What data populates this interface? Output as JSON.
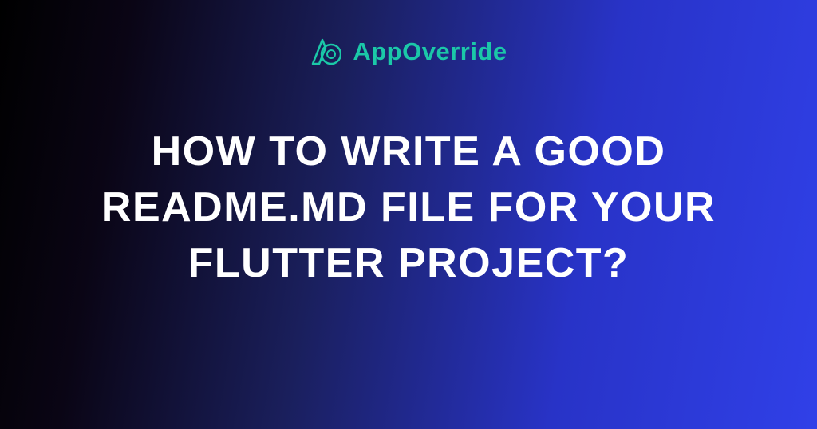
{
  "logo": {
    "name": "AppOverride",
    "iconColor": "#1bc8a8"
  },
  "heading": "How to write a good readme.md file for your Flutter project?"
}
